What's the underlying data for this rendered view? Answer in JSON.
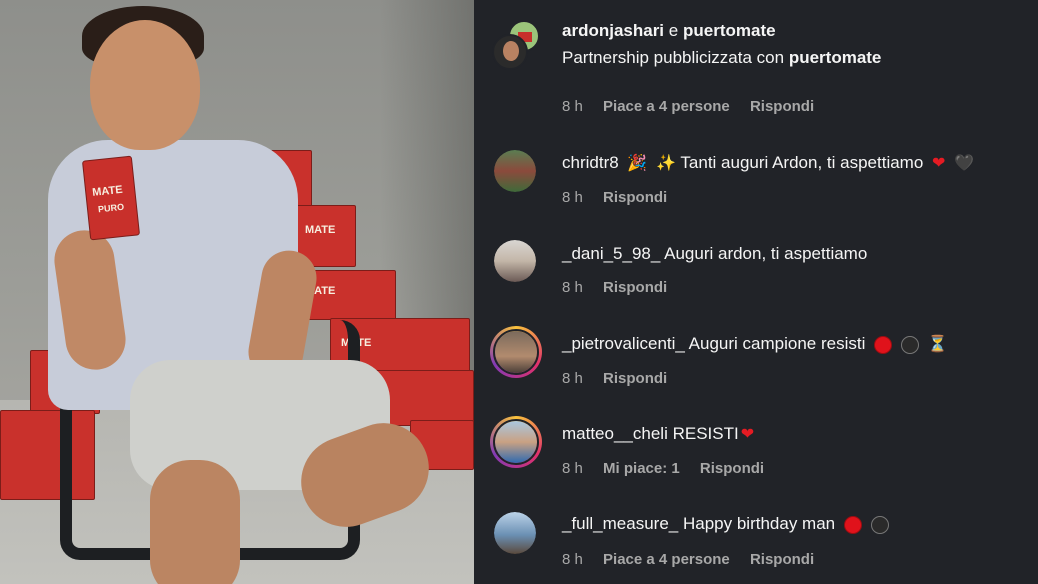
{
  "comments": [
    {
      "author": "ardonjashari",
      "joiner": "e",
      "coauthor": "puertomate",
      "subline_prefix": "Partnership pubblicizzata con",
      "subline_brand": "puertomate",
      "time": "8 h",
      "likes": "Piace a 4 persone",
      "reply": "Rispondi"
    },
    {
      "author": "chridtr8",
      "text": "Tanti auguri Ardon, ti aspettiamo",
      "emoji_pre": [
        "🎉",
        "✨"
      ],
      "emoji_post": [
        "❤",
        "🖤"
      ],
      "time": "8 h",
      "reply": "Rispondi"
    },
    {
      "author": "_dani_5_98_",
      "text": "Auguri ardon, ti aspettiamo",
      "time": "8 h",
      "reply": "Rispondi"
    },
    {
      "author": "_pietrovalicenti_",
      "text": "Auguri campione resisti",
      "emoji_post": [
        "red-circle",
        "black-circle",
        "hourglass"
      ],
      "time": "8 h",
      "reply": "Rispondi"
    },
    {
      "author": "matteo__cheli",
      "text": "RESISTI",
      "emoji_post": [
        "❤"
      ],
      "time": "8 h",
      "likes": "Mi piace: 1",
      "reply": "Rispondi"
    },
    {
      "author": "_full_measure_",
      "text": "Happy birthday man",
      "emoji_post": [
        "red-circle",
        "black-circle"
      ],
      "time": "8 h",
      "likes": "Piace a 4 persone",
      "reply": "Rispondi"
    }
  ],
  "photo": {
    "carton_brand": "MATE",
    "carton_sub": "PURO"
  },
  "colors": {
    "panel_bg": "#212328",
    "text": "#f5f5f5",
    "meta": "#a8a8a8",
    "brand_red": "#c8302b"
  }
}
